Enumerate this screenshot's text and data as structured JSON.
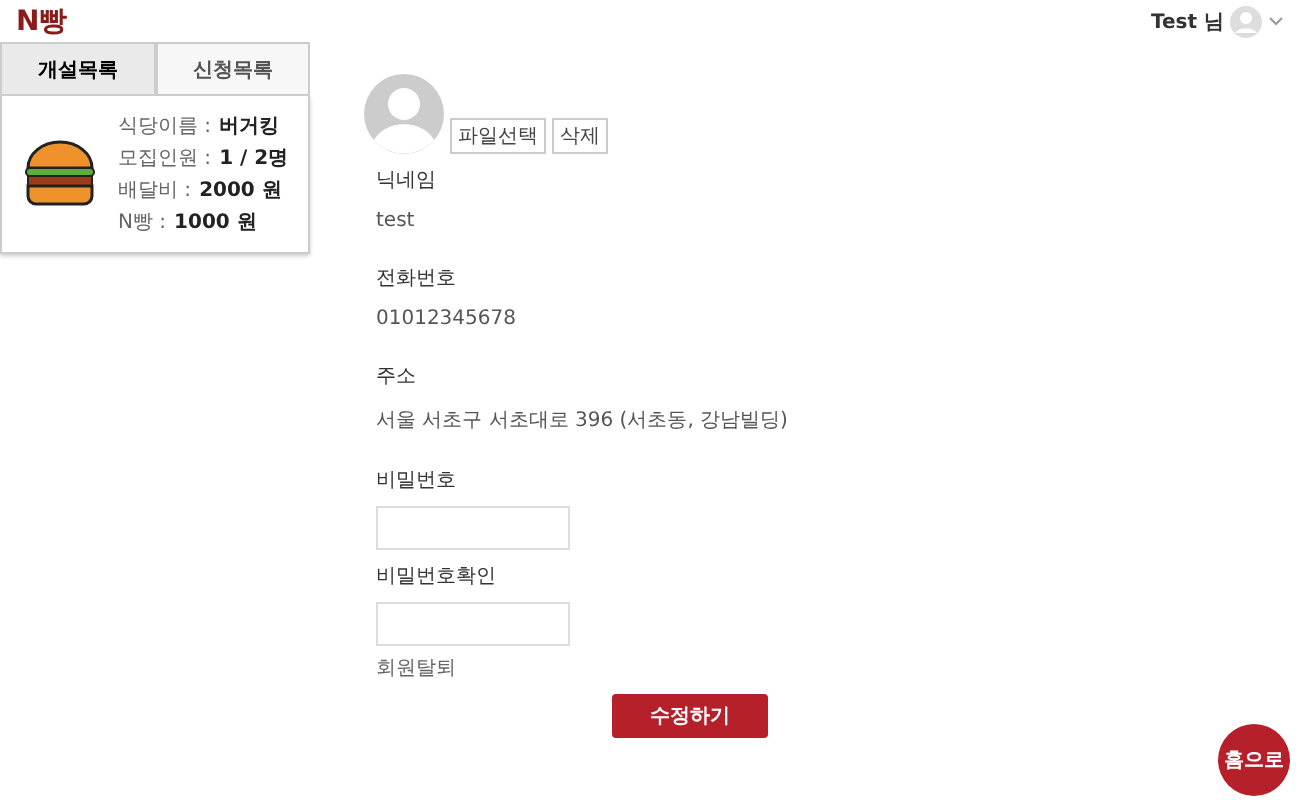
{
  "header": {
    "logo": "N빵",
    "user": "Test 님"
  },
  "tabs": [
    {
      "label": "개설목록",
      "selected": true
    },
    {
      "label": "신청목록",
      "selected": false
    }
  ],
  "card": {
    "rows": [
      {
        "label": "식당이름 :",
        "value": "버거킹"
      },
      {
        "label": "모집인원 :",
        "value": "1 / 2명"
      },
      {
        "label": "배달비 :",
        "value": "2000 원"
      },
      {
        "label": "N빵 :",
        "value": "1000 원"
      }
    ]
  },
  "profile": {
    "file_button": "파일선택",
    "delete_button": "삭제",
    "fields": [
      {
        "kind": "text",
        "label": "닉네임",
        "value": "test"
      },
      {
        "kind": "text",
        "label": "전화번호",
        "value": "01012345678"
      },
      {
        "kind": "text",
        "label": "주소",
        "value": "서울 서초구 서초대로 396 (서초동, 강남빌딩)"
      },
      {
        "kind": "input",
        "label": "비밀번호"
      },
      {
        "kind": "input",
        "label": "비밀번호확인"
      }
    ],
    "withdraw": "회원탈퇴",
    "submit": "수정하기"
  },
  "float_button": "홈으로"
}
